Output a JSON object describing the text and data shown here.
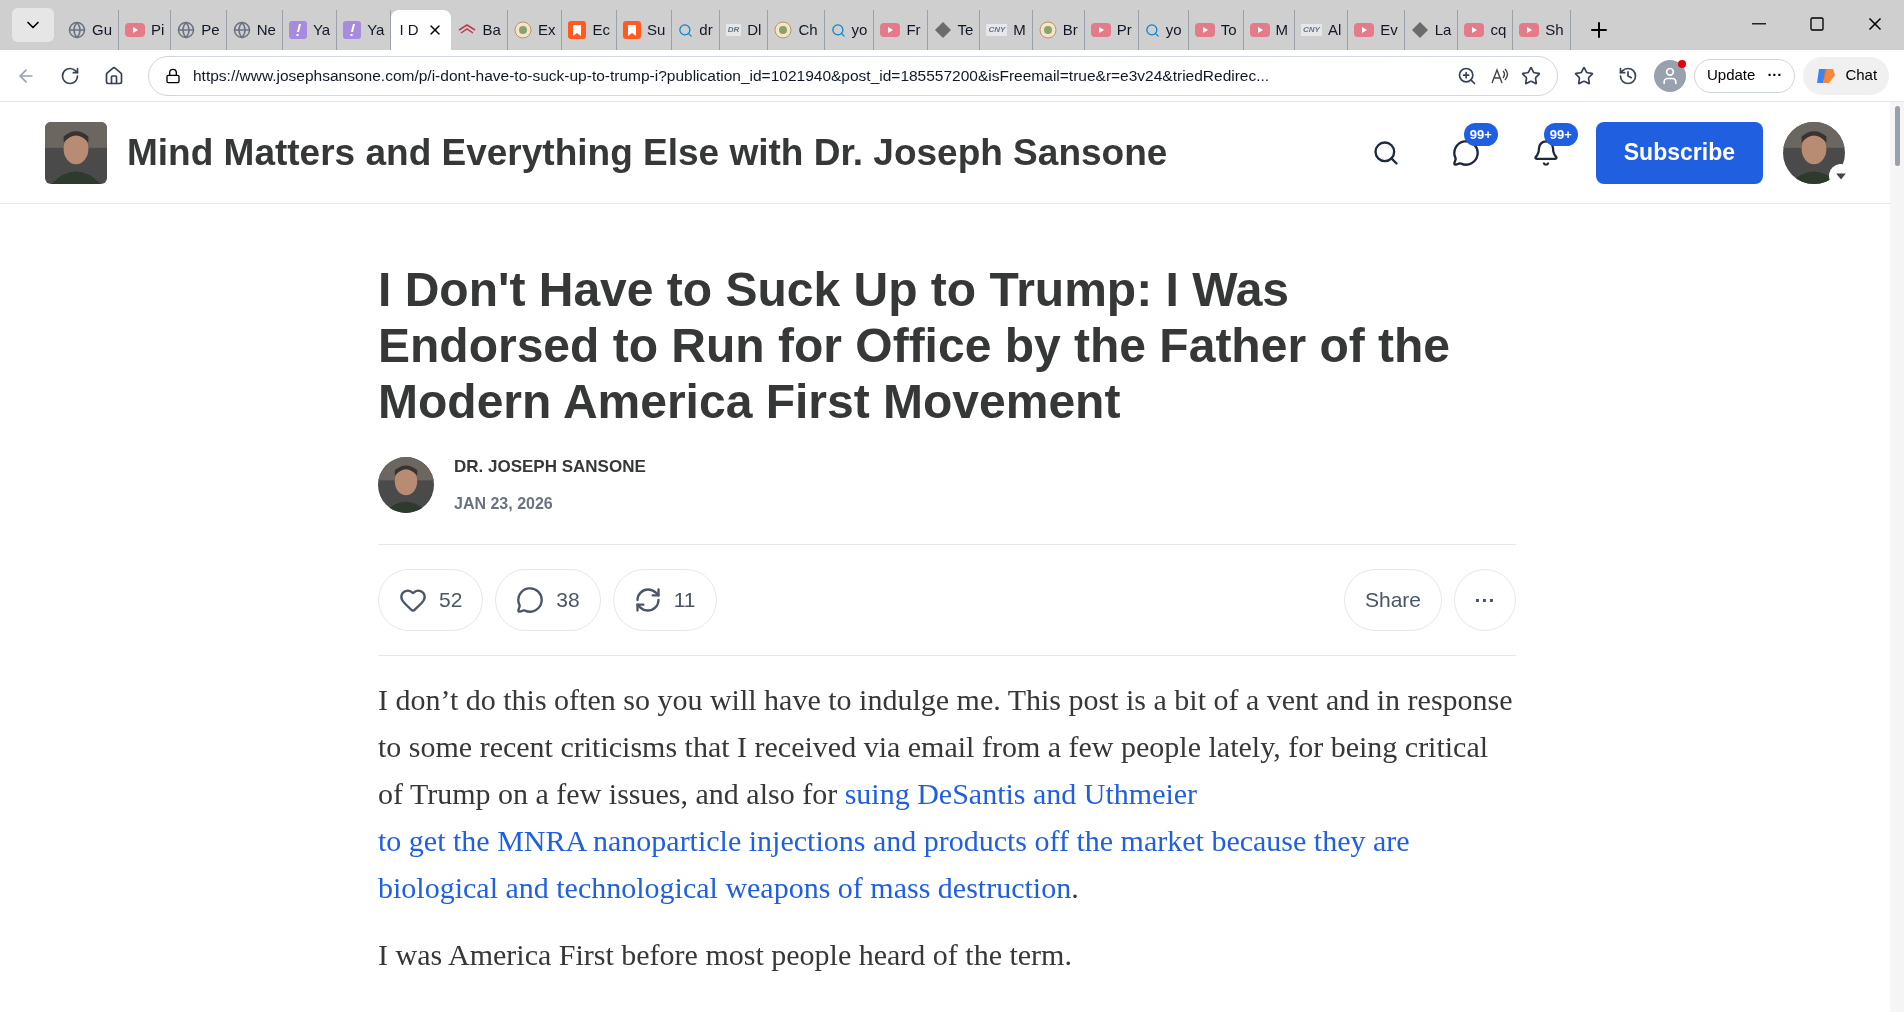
{
  "tabs": [
    {
      "label": "Gu",
      "kind": "globe",
      "selected": false
    },
    {
      "label": "Pi",
      "kind": "video",
      "selected": false
    },
    {
      "label": "Pe",
      "kind": "globe",
      "selected": false
    },
    {
      "label": "Ne",
      "kind": "globe",
      "selected": false
    },
    {
      "label": "Ya",
      "kind": "exclaim",
      "selected": false
    },
    {
      "label": "Ya",
      "kind": "exclaim",
      "selected": false
    },
    {
      "label": "I D",
      "kind": "plain",
      "selected": true
    },
    {
      "label": "Ba",
      "kind": "bank",
      "selected": false
    },
    {
      "label": "Ex",
      "kind": "seal",
      "selected": false
    },
    {
      "label": "Ec",
      "kind": "bookmark",
      "selected": false
    },
    {
      "label": "Su",
      "kind": "bookmark",
      "selected": false
    },
    {
      "label": "dr",
      "kind": "search",
      "selected": false
    },
    {
      "label": "Dl",
      "kind": "text",
      "icon_text": "DR",
      "selected": false
    },
    {
      "label": "Ch",
      "kind": "seal",
      "selected": false
    },
    {
      "label": "yo",
      "kind": "search",
      "selected": false
    },
    {
      "label": "Fr",
      "kind": "video",
      "selected": false
    },
    {
      "label": "Te",
      "kind": "diamond",
      "selected": false
    },
    {
      "label": "M",
      "kind": "text",
      "icon_text": "CNY",
      "selected": false
    },
    {
      "label": "Br",
      "kind": "seal",
      "selected": false
    },
    {
      "label": "Pr",
      "kind": "video",
      "selected": false
    },
    {
      "label": "yo",
      "kind": "search",
      "selected": false
    },
    {
      "label": "To",
      "kind": "video",
      "selected": false
    },
    {
      "label": "M",
      "kind": "video",
      "selected": false
    },
    {
      "label": "Al",
      "kind": "text",
      "icon_text": "CNY",
      "selected": false
    },
    {
      "label": "Ev",
      "kind": "video",
      "selected": false
    },
    {
      "label": "La",
      "kind": "diamond",
      "selected": false
    },
    {
      "label": "cq",
      "kind": "video",
      "selected": false
    },
    {
      "label": "Sh",
      "kind": "video",
      "selected": false
    }
  ],
  "address_bar": {
    "url": "https://www.josephsansone.com/p/i-dont-have-to-suck-up-to-trump-i?publication_id=1021940&post_id=185557200&isFreemail=true&r=e3v24&triedRedirec..."
  },
  "toolbar": {
    "update_button": "Update",
    "more_button": "···",
    "chat_button": "Chat",
    "profile_notification": true
  },
  "header": {
    "publication_title": "Mind Matters and Everything Else with Dr. Joseph Sansone",
    "chat_badge": "99+",
    "notification_badge": "99+",
    "subscribe_button": "Subscribe"
  },
  "post": {
    "title": "I Don't Have to Suck Up to Trump: I Was Endorsed to Run for Office by the Father of the Modern America First Movement",
    "author": "DR. JOSEPH SANSONE",
    "date": "JAN 23, 2026",
    "likes": "52",
    "comments": "38",
    "restacks": "11",
    "share_button": "Share",
    "more_button": "···",
    "paragraphs": [
      {
        "text": "I don’t do this often so you will have to indulge me. This post is a bit of a vent and in response to some recent criticisms that I received via email from a few people lately, for being critical of Trump on a few issues, and also for ",
        "links": [
          "suing DeSantis and Uthmeier",
          "to get the MNRA nanoparticle injections and products off the market because they are",
          "biological and technological weapons of mass destruction"
        ],
        "after": "."
      },
      {
        "text": "I was America First before most people heard of the term."
      }
    ]
  }
}
